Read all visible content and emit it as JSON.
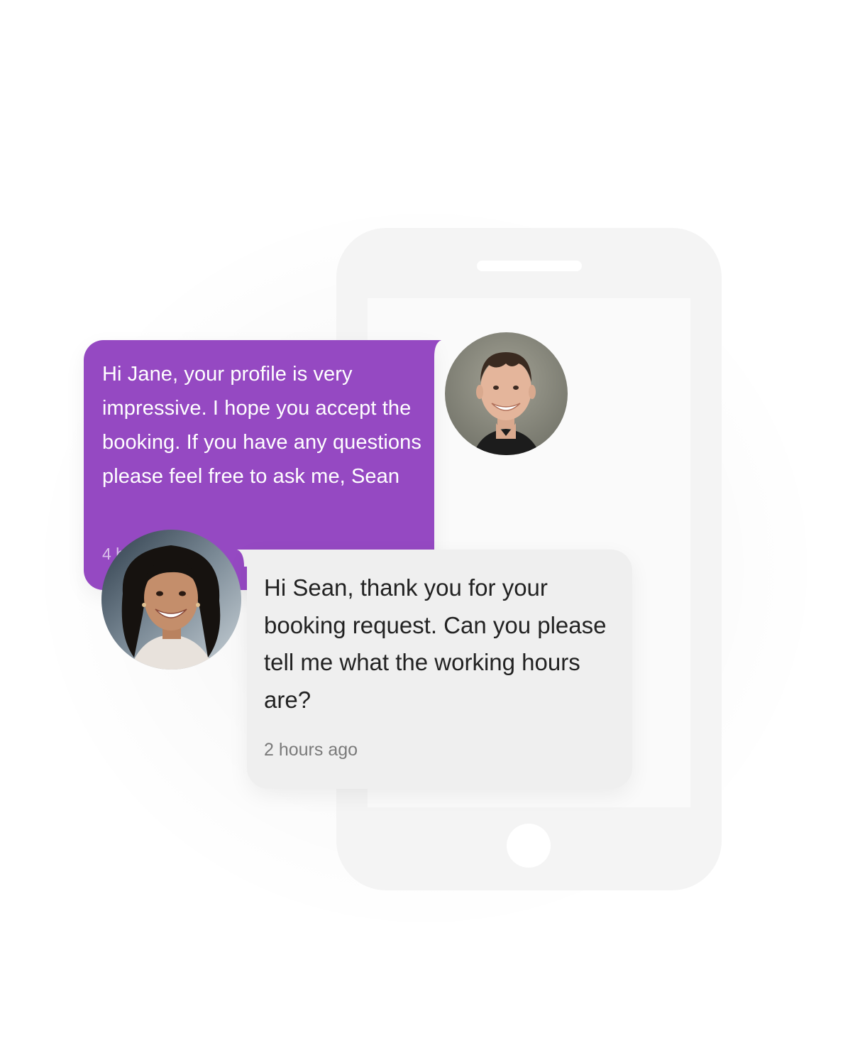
{
  "messages": [
    {
      "sender": "Sean",
      "text": "Hi Jane, your profile is very impressive. I hope you accept the booking. If you have any questions please feel free to ask me, Sean",
      "time": "4 h",
      "bubble_color": "#9549c2",
      "text_color": "#ffffff"
    },
    {
      "sender": "Jane",
      "text": "Hi Sean, thank you for your booking request. Can you please tell me what the working hours are?",
      "time": "2 hours ago",
      "bubble_color": "#efefef",
      "text_color": "#222222"
    }
  ],
  "icons": {
    "phone": "phone-outline-icon",
    "avatar_sean": "avatar-sean",
    "avatar_jane": "avatar-jane"
  }
}
